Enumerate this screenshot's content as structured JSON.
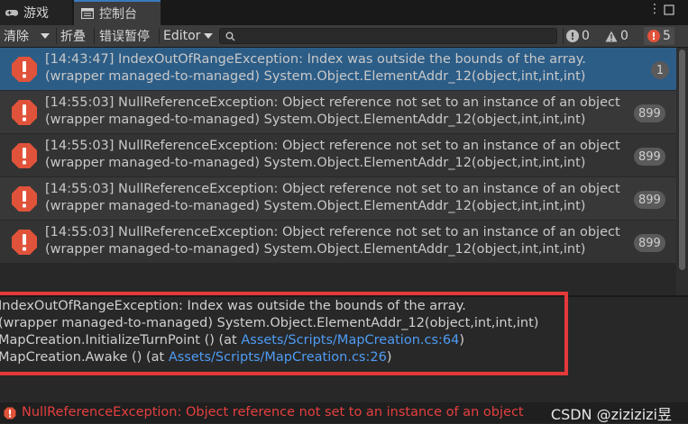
{
  "tabs": {
    "game_label": "游戏",
    "console_label": "控制台"
  },
  "toolbar": {
    "clear_label": "清除",
    "collapse_label": "折叠",
    "error_pause_label": "错误暂停",
    "editor_label": "Editor",
    "search_placeholder": "",
    "info_count": "0",
    "warning_count": "0",
    "error_count": "5"
  },
  "colors": {
    "error_red": "#e0533a",
    "selected_row": "#2c5d87",
    "link_blue": "#4e9cf5",
    "highlight_box": "#e43a3a"
  },
  "logs": [
    {
      "line1": "[14:43:47] IndexOutOfRangeException: Index was outside the bounds of the array.",
      "line2": "(wrapper managed-to-managed) System.Object.ElementAddr_12(object,int,int,int)",
      "count": "1",
      "selected": true
    },
    {
      "line1": "[14:55:03] NullReferenceException: Object reference not set to an instance of an object",
      "line2": "(wrapper managed-to-managed) System.Object.ElementAddr_12(object,int,int,int)",
      "count": "899",
      "selected": false
    },
    {
      "line1": "[14:55:03] NullReferenceException: Object reference not set to an instance of an object",
      "line2": "(wrapper managed-to-managed) System.Object.ElementAddr_12(object,int,int,int)",
      "count": "899",
      "selected": false
    },
    {
      "line1": "[14:55:03] NullReferenceException: Object reference not set to an instance of an object",
      "line2": "(wrapper managed-to-managed) System.Object.ElementAddr_12(object,int,int,int)",
      "count": "899",
      "selected": false
    },
    {
      "line1": "[14:55:03] NullReferenceException: Object reference not set to an instance of an object",
      "line2": "(wrapper managed-to-managed) System.Object.ElementAddr_12(object,int,int,int)",
      "count": "899",
      "selected": false
    }
  ],
  "detail": {
    "line1": "IndexOutOfRangeException: Index was outside the bounds of the array.",
    "line2": "(wrapper managed-to-managed) System.Object.ElementAddr_12(object,int,int,int)",
    "line3_prefix": "MapCreation.InitializeTurnPoint () (at ",
    "line3_link": "Assets/Scripts/MapCreation.cs:64",
    "line3_suffix": ")",
    "line4_prefix": "MapCreation.Awake () (at ",
    "line4_link": "Assets/Scripts/MapCreation.cs:26",
    "line4_suffix": ")"
  },
  "status": {
    "message": "NullReferenceException: Object reference not set to an instance of an object",
    "watermark": "CSDN @zizizizi昱"
  }
}
